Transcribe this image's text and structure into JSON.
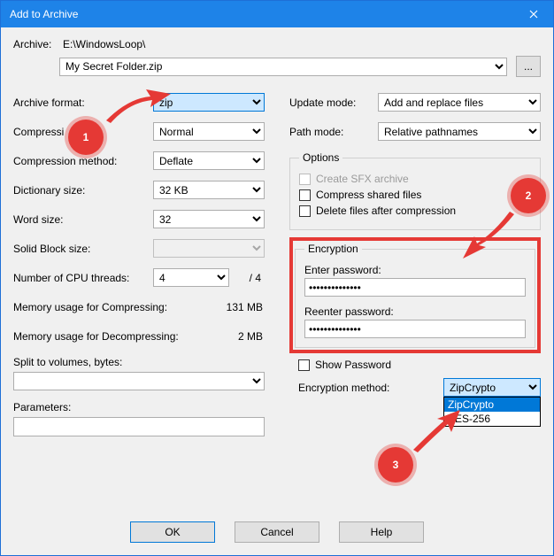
{
  "window": {
    "title": "Add to Archive"
  },
  "archive": {
    "label": "Archive:",
    "path": "E:\\WindowsLoop\\",
    "filename": "My Secret Folder.zip",
    "browse": "..."
  },
  "left": {
    "format_label": "Archive format:",
    "format_value": "zip",
    "compression_label": "Compressi",
    "compression_value": "Normal",
    "method_label": "Compression method:",
    "method_value": "Deflate",
    "dict_label": "Dictionary size:",
    "dict_value": "32 KB",
    "word_label": "Word size:",
    "word_value": "32",
    "block_label": "Solid Block size:",
    "block_value": "",
    "cpu_label": "Number of CPU threads:",
    "cpu_value": "4",
    "cpu_total": "/ 4",
    "mem_comp_label": "Memory usage for Compressing:",
    "mem_comp_value": "131 MB",
    "mem_decomp_label": "Memory usage for Decompressing:",
    "mem_decomp_value": "2 MB",
    "split_label": "Split to volumes, bytes:",
    "param_label": "Parameters:"
  },
  "right": {
    "update_label": "Update mode:",
    "update_value": "Add and replace files",
    "path_label": "Path mode:",
    "path_value": "Relative pathnames",
    "options_legend": "Options",
    "sfx": "Create SFX archive",
    "shared": "Compress shared files",
    "delete": "Delete files after compression",
    "enc_legend": "Encryption",
    "enter_pwd": "Enter password:",
    "reenter_pwd": "Reenter password:",
    "pwd_mask": "••••••••••••••",
    "show_pwd": "Show Password",
    "enc_method_label": "Encryption method:",
    "enc_method_value": "ZipCrypto",
    "enc_options": [
      "ZipCrypto",
      "AES-256"
    ]
  },
  "buttons": {
    "ok": "OK",
    "cancel": "Cancel",
    "help": "Help"
  },
  "badges": {
    "b1": "1",
    "b2": "2",
    "b3": "3"
  }
}
